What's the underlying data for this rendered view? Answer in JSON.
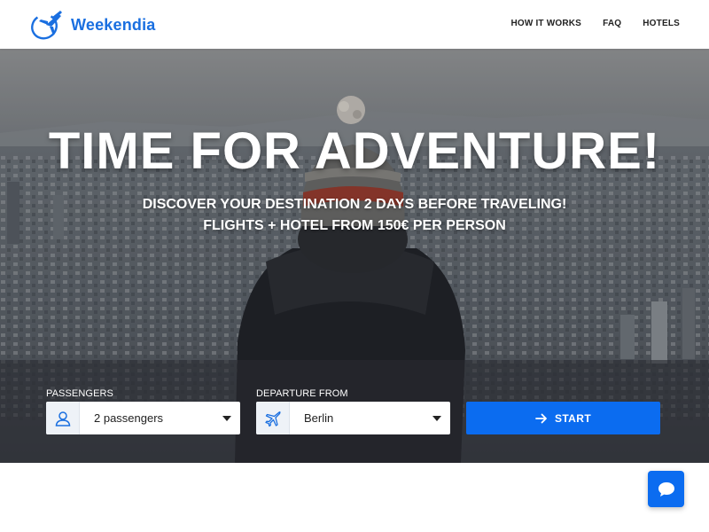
{
  "brand": {
    "name": "Weekendia",
    "accent_color": "#1a6fe0",
    "logo_icon": "plane-circle-icon"
  },
  "nav": {
    "items": [
      "HOW IT WORKS",
      "FAQ",
      "HOTELS"
    ]
  },
  "hero": {
    "headline": "TIME FOR ADVENTURE!",
    "subline_1": "DISCOVER YOUR DESTINATION 2 DAYS BEFORE TRAVELING!",
    "subline_2": "FLIGHTS + HOTEL FROM 150€ PER PERSON",
    "background": "photo-person-in-beanie-overlooking-city"
  },
  "booking": {
    "passengers": {
      "label": "PASSENGERS",
      "value": "2 passengers",
      "icon": "user-icon"
    },
    "departure": {
      "label": "DEPARTURE FROM",
      "value": "Berlin",
      "icon": "plane-icon"
    },
    "start_button": {
      "label": "START",
      "icon": "arrow-right-icon",
      "color": "#0b6cf0"
    }
  },
  "chat": {
    "icon": "chat-bubble-icon",
    "color": "#0b6cf0"
  }
}
